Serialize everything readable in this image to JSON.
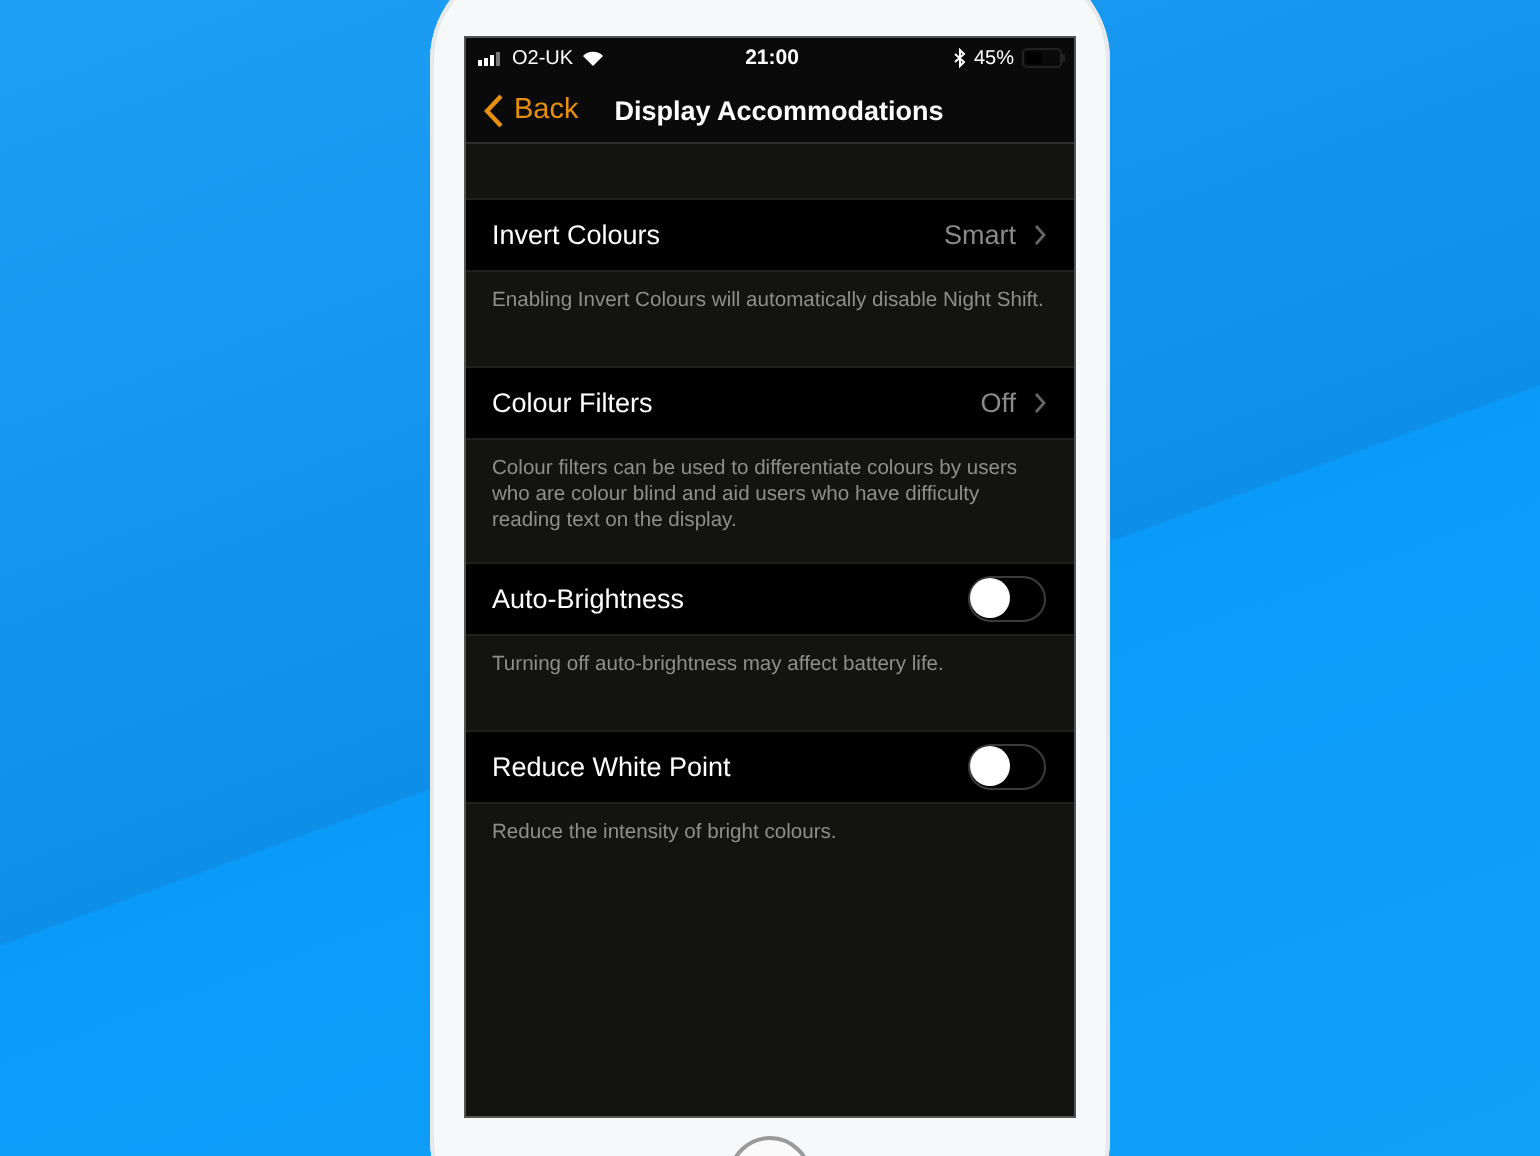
{
  "status_bar": {
    "carrier": "O2-UK",
    "time": "21:00",
    "battery": "45%"
  },
  "nav_bar": {
    "back": "Back",
    "title": "Display Accommodations"
  },
  "sections": [
    {
      "kind": "disclosure",
      "label": "Invert Colours",
      "value": "Smart",
      "footer": "Enabling Invert Colours will automatically disable Night Shift."
    },
    {
      "kind": "disclosure",
      "label": "Colour Filters",
      "value": "Off",
      "footer": "Colour filters can be used to differentiate colours by users who are colour blind and aid users who have difficulty reading text on the display."
    },
    {
      "kind": "switch",
      "label": "Auto-Brightness",
      "on": false,
      "footer": "Turning off auto-brightness may affect battery life."
    },
    {
      "kind": "switch",
      "label": "Reduce White Point",
      "on": false,
      "footer": "Reduce the intensity of bright colours."
    }
  ]
}
